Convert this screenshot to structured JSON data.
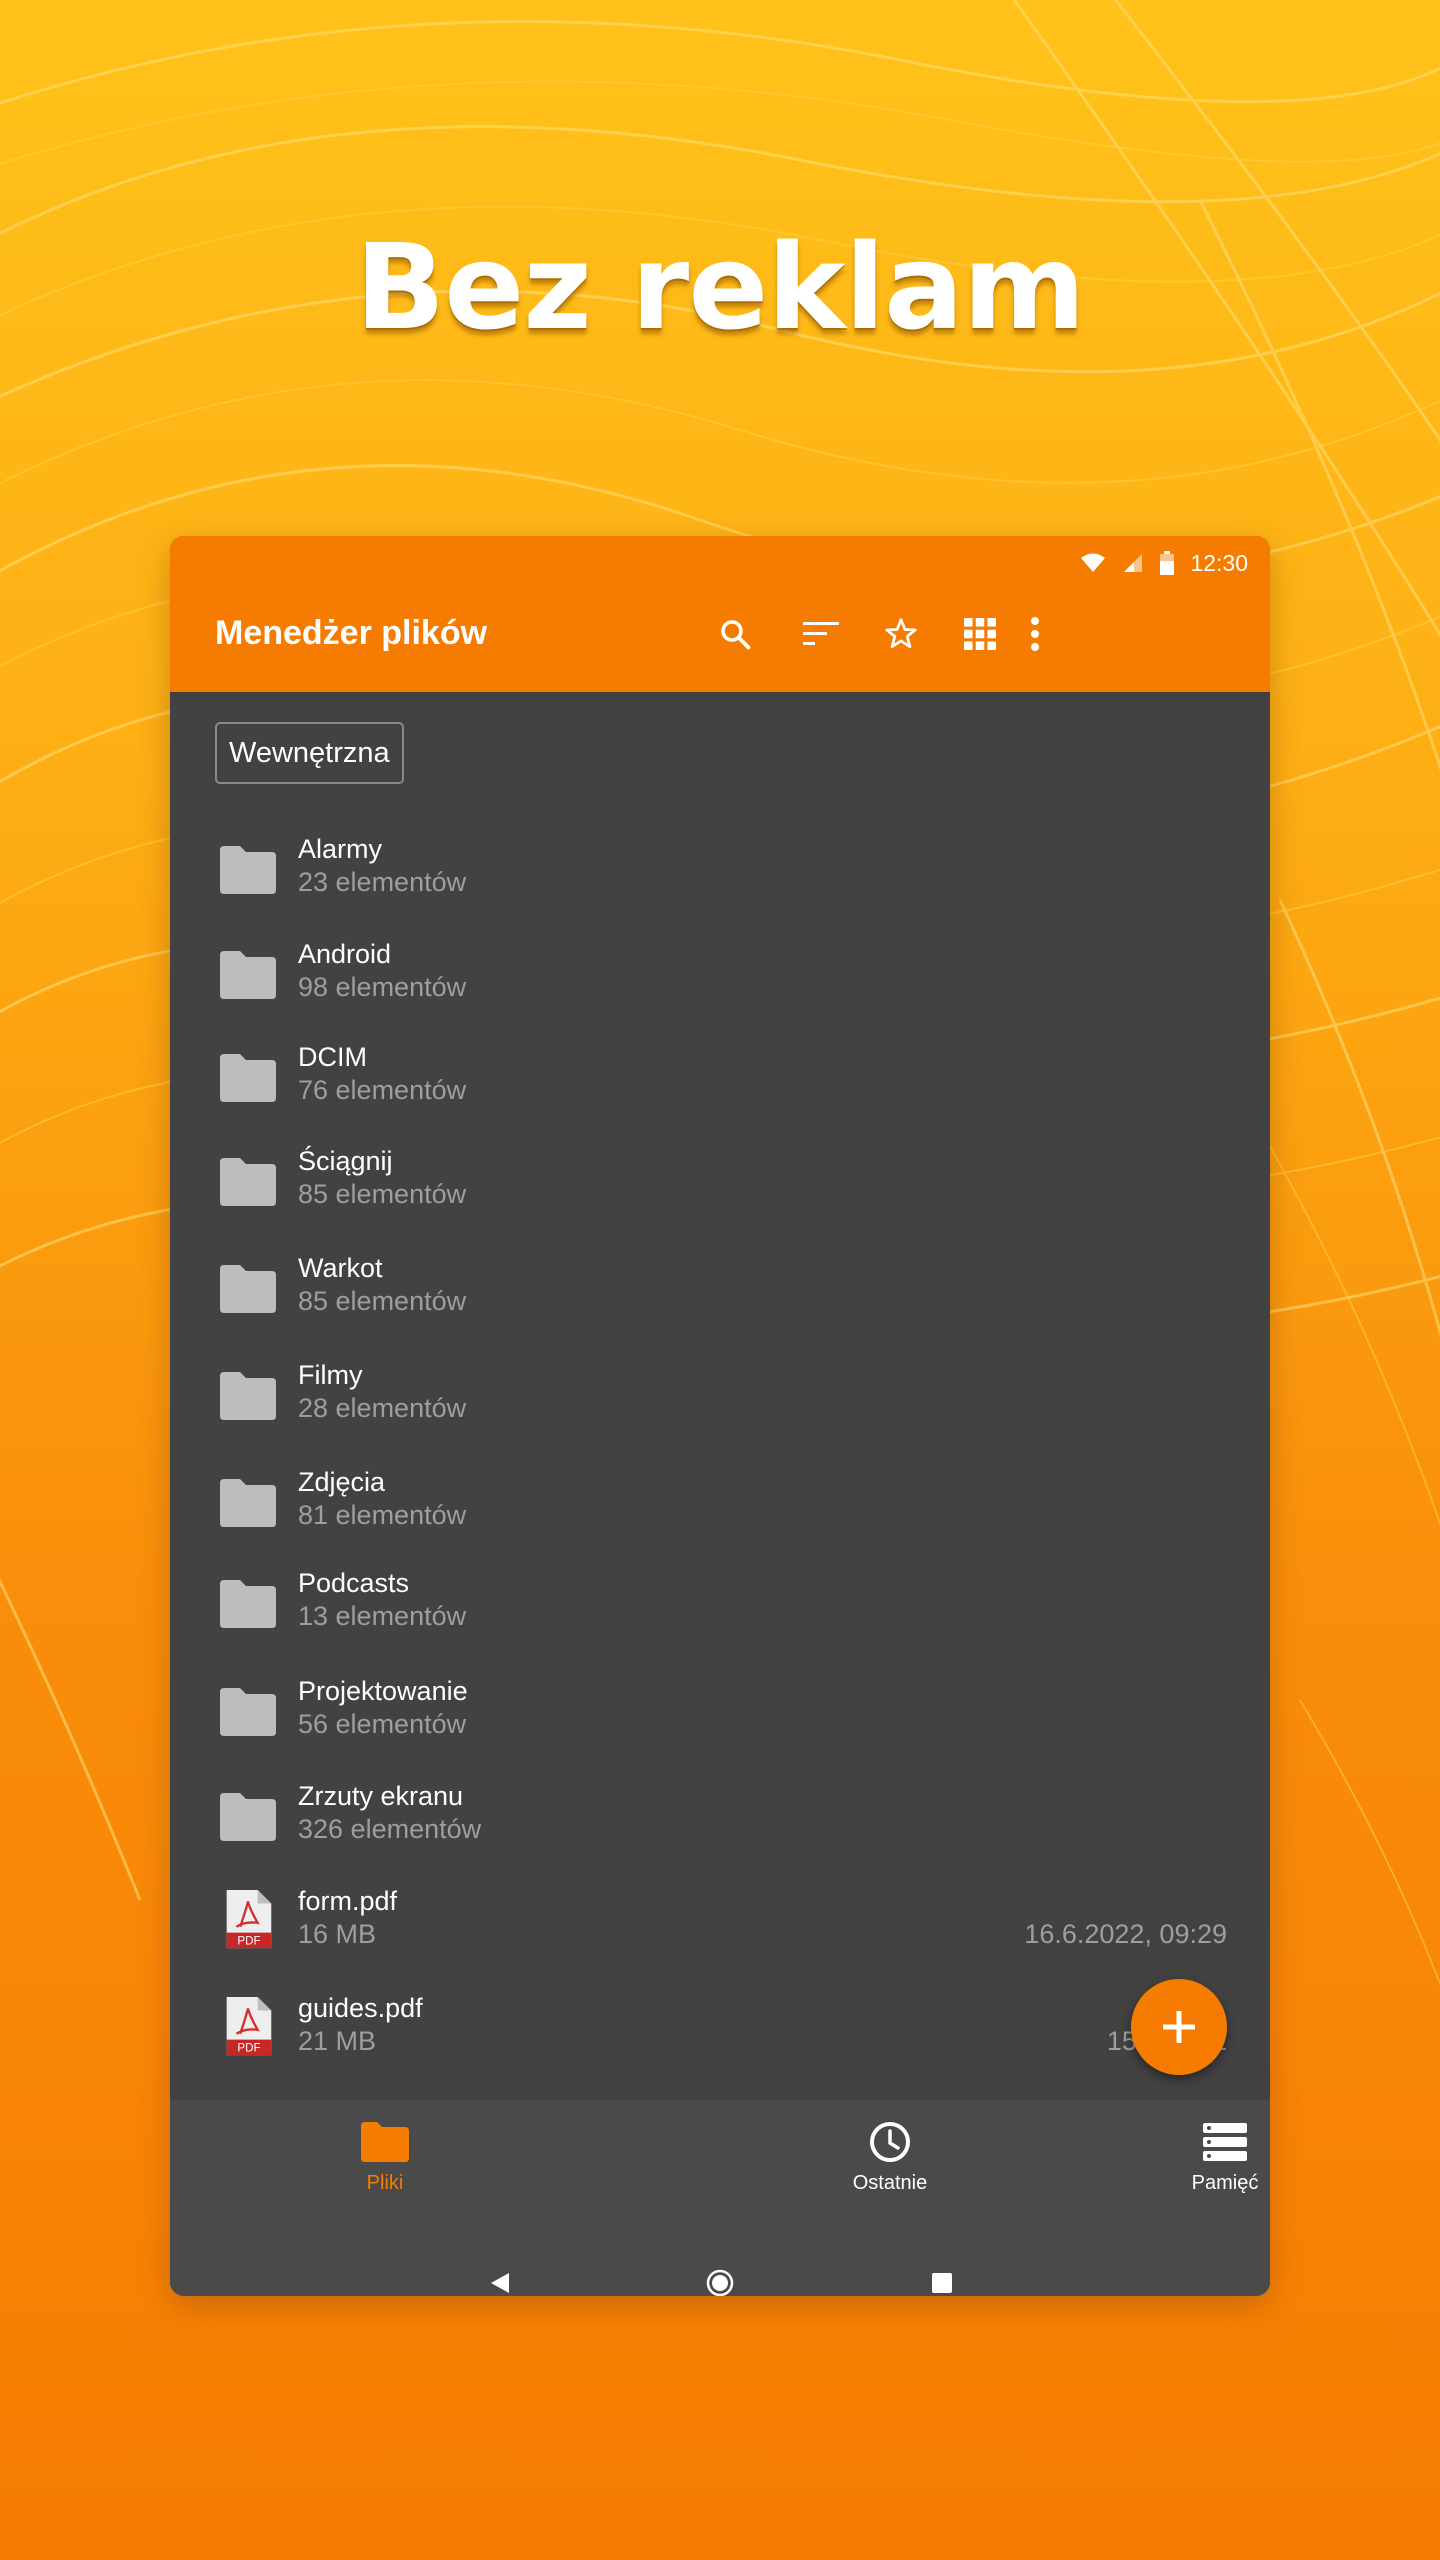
{
  "headline": "Bez reklam",
  "status_bar": {
    "time": "12:30"
  },
  "app_bar": {
    "title": "Menedżer plików",
    "actions": [
      "search-icon",
      "sort-icon",
      "star-icon",
      "grid-view-icon",
      "more-vert-icon"
    ]
  },
  "storage_chip": "Wewnętrzna",
  "files": [
    {
      "name": "Alarmy",
      "meta": "23 elementów",
      "type": "folder"
    },
    {
      "name": "Android",
      "meta": "98 elementów",
      "type": "folder"
    },
    {
      "name": "DCIM",
      "meta": "76 elementów",
      "type": "folder"
    },
    {
      "name": "Ściągnij",
      "meta": "85 elementów",
      "type": "folder"
    },
    {
      "name": "Warkot",
      "meta": "85 elementów",
      "type": "folder"
    },
    {
      "name": "Filmy",
      "meta": "28 elementów",
      "type": "folder"
    },
    {
      "name": "Zdjęcia",
      "meta": "81 elementów",
      "type": "folder"
    },
    {
      "name": "Podcasts",
      "meta": "13 elementów",
      "type": "folder"
    },
    {
      "name": "Projektowanie",
      "meta": "56 elementów",
      "type": "folder"
    },
    {
      "name": "Zrzuty ekranu",
      "meta": "326 elementów",
      "type": "folder"
    },
    {
      "name": "form.pdf",
      "meta": "16 MB",
      "date": "16.6.2022, 09:29",
      "type": "pdf"
    },
    {
      "name": "guides.pdf",
      "meta": "21 MB",
      "date": "15.6.2022",
      "type": "pdf"
    }
  ],
  "pdf_badge": "PDF",
  "bottom_nav": [
    {
      "label": "Pliki",
      "icon": "folder-icon",
      "active": true
    },
    {
      "label": "Ostatnie",
      "icon": "clock-icon",
      "active": false
    },
    {
      "label": "Pamięć",
      "icon": "storage-icon",
      "active": false
    }
  ],
  "colors": {
    "accent": "#F57C00",
    "surface": "#424242",
    "bottom_nav_bg": "#4a4a4a",
    "folder_icon": "#BDBDBD",
    "secondary_text": "#9E9E9E"
  }
}
